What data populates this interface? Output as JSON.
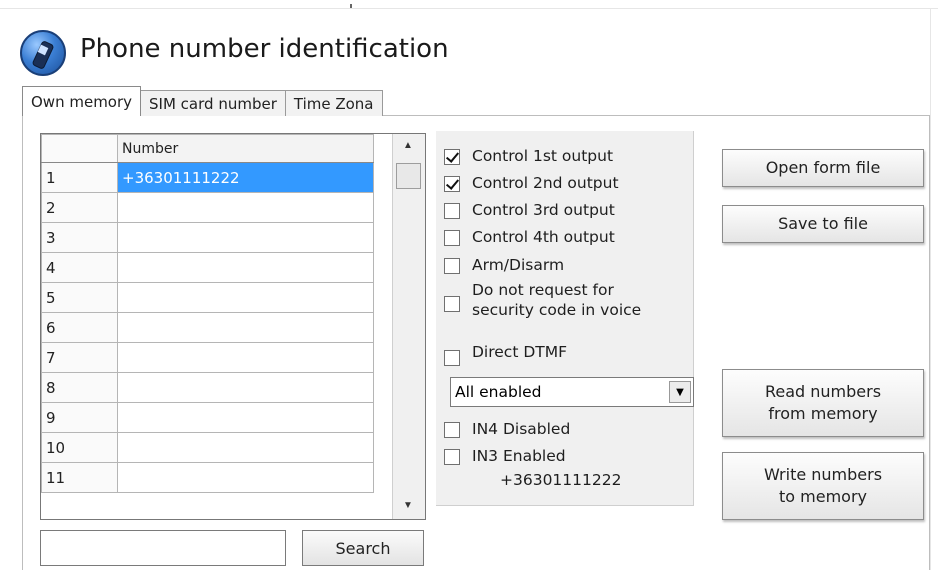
{
  "header": {
    "title": "Phone number identification",
    "icon": "phone-icon"
  },
  "tabs": [
    {
      "label": "Own memory",
      "active": true
    },
    {
      "label": "SIM card number",
      "active": false
    },
    {
      "label": "Time Zona",
      "active": false
    }
  ],
  "grid": {
    "column_header": "Number",
    "rows": [
      {
        "index": "1",
        "number": "+36301111222",
        "selected": true
      },
      {
        "index": "2",
        "number": ""
      },
      {
        "index": "3",
        "number": ""
      },
      {
        "index": "4",
        "number": ""
      },
      {
        "index": "5",
        "number": ""
      },
      {
        "index": "6",
        "number": ""
      },
      {
        "index": "7",
        "number": ""
      },
      {
        "index": "8",
        "number": ""
      },
      {
        "index": "9",
        "number": ""
      },
      {
        "index": "10",
        "number": ""
      },
      {
        "index": "11",
        "number": ""
      }
    ]
  },
  "search": {
    "value": "",
    "button_label": "Search"
  },
  "options": {
    "control1": {
      "label": "Control 1st output",
      "checked": true
    },
    "control2": {
      "label": "Control 2nd output",
      "checked": true
    },
    "control3": {
      "label": "Control 3rd output",
      "checked": false
    },
    "control4": {
      "label": "Control 4th output",
      "checked": false
    },
    "arm": {
      "label": "Arm/Disarm",
      "checked": false
    },
    "nosec": {
      "label": "Do not request for security code in voice",
      "checked": false
    },
    "dtmf": {
      "label": "Direct DTMF",
      "checked": false
    },
    "dropdown_value": "All enabled",
    "in4": {
      "label": "IN4 Disabled",
      "checked": false
    },
    "in3": {
      "label": "IN3 Enabled",
      "checked": false
    },
    "readout": "+36301111222"
  },
  "buttons": {
    "open_file": "Open form file",
    "save_file": "Save to file",
    "read_line1": "Read numbers",
    "read_line2": "from memory",
    "write_line1": "Write numbers",
    "write_line2": "to memory"
  }
}
